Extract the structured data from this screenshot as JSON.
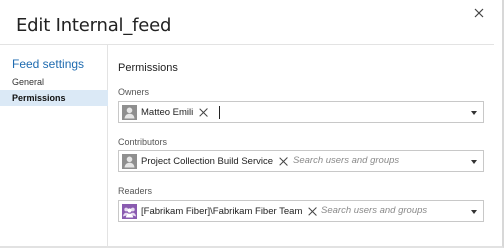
{
  "dialog": {
    "title": "Edit Internal_feed",
    "close_icon": "close-icon"
  },
  "sidebar": {
    "heading": "Feed settings",
    "items": [
      {
        "label": "General",
        "selected": false
      },
      {
        "label": "Permissions",
        "selected": true
      }
    ],
    "selected_bg": "#dbe9f6",
    "heading_color": "#1e6bb0"
  },
  "permissions": {
    "title": "Permissions",
    "owners": {
      "label": "Owners",
      "chips": [
        {
          "name": "Matteo Emili",
          "icon": "user-avatar-icon"
        }
      ],
      "placeholder": ""
    },
    "contributors": {
      "label": "Contributors",
      "chips": [
        {
          "name": "Project Collection Build Service",
          "icon": "user-avatar-icon"
        }
      ],
      "placeholder": "Search users and groups"
    },
    "readers": {
      "label": "Readers",
      "chips": [
        {
          "name": "[Fabrikam Fiber]\\Fabrikam Fiber Team",
          "icon": "team-avatar-icon"
        }
      ],
      "placeholder": "Search users and groups"
    }
  }
}
